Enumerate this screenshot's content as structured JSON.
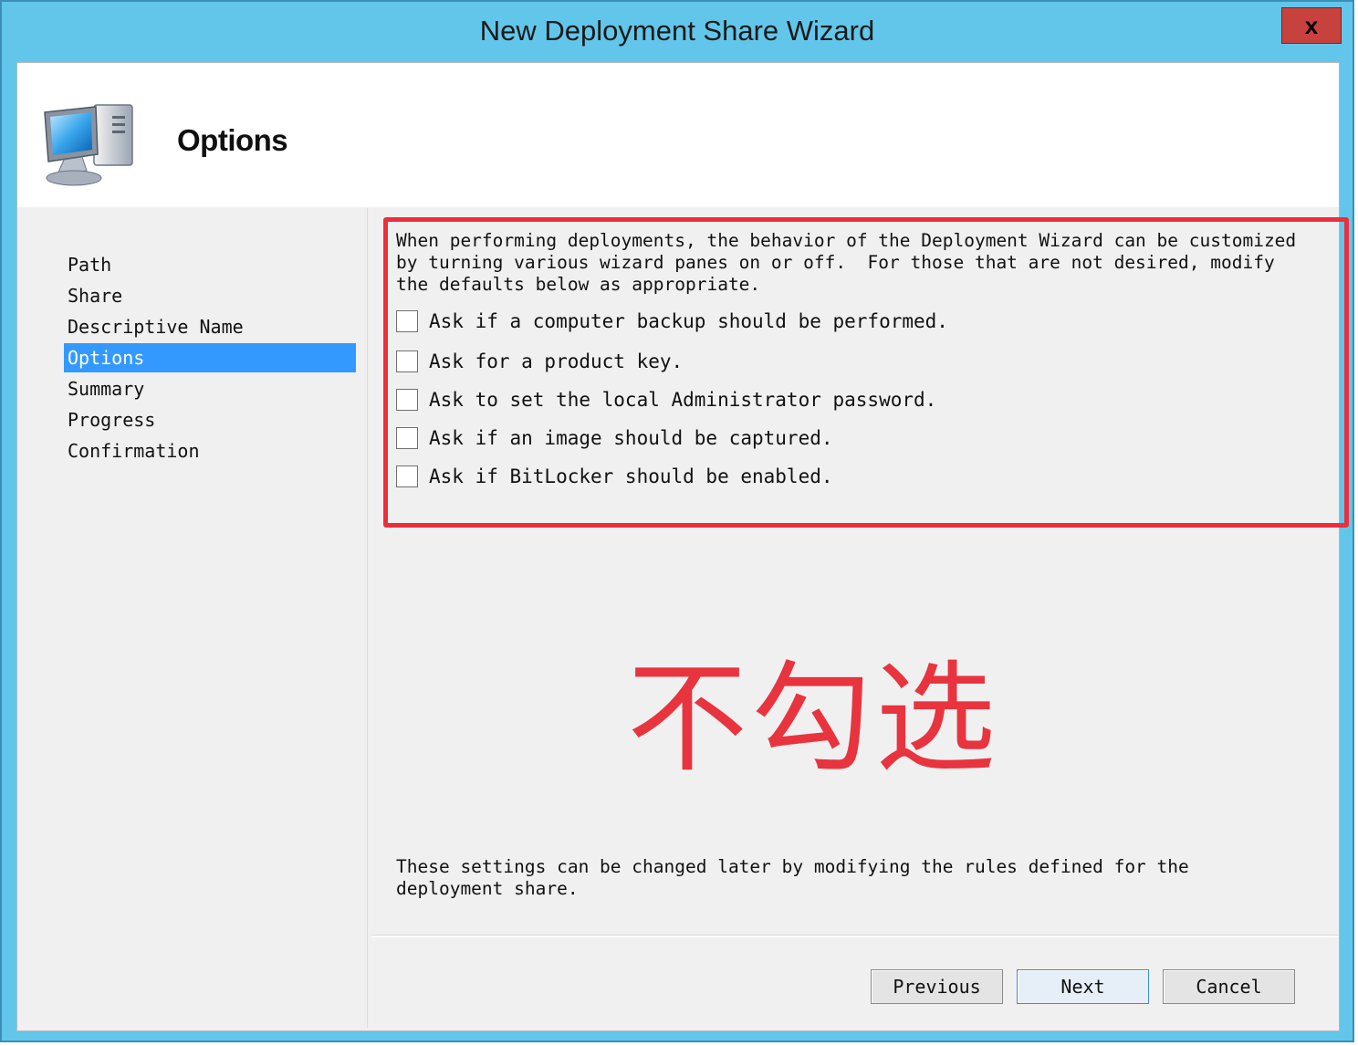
{
  "window": {
    "title": "New Deployment Share Wizard",
    "close_label": "x"
  },
  "header": {
    "title": "Options",
    "icon": "computer-icon"
  },
  "sidebar": {
    "items": [
      {
        "label": "Path",
        "active": false
      },
      {
        "label": "Share",
        "active": false
      },
      {
        "label": "Descriptive Name",
        "active": false
      },
      {
        "label": "Options",
        "active": true
      },
      {
        "label": "Summary",
        "active": false
      },
      {
        "label": "Progress",
        "active": false
      },
      {
        "label": "Confirmation",
        "active": false
      }
    ]
  },
  "content": {
    "intro": "When performing deployments, the behavior of the Deployment Wizard can be customized\nby turning various wizard panes on or off.  For those that are not desired, modify\nthe defaults below as appropriate.",
    "options": [
      {
        "label": "Ask if a computer backup should be performed.",
        "checked": false
      },
      {
        "label": "Ask for a product key.",
        "checked": false
      },
      {
        "label": "Ask to set the local Administrator password.",
        "checked": false
      },
      {
        "label": "Ask if an image should be captured.",
        "checked": false
      },
      {
        "label": "Ask if BitLocker should be enabled.",
        "checked": false
      }
    ],
    "annotation": "不勾选",
    "annotation_color": "#e8343e",
    "footer_note": "These settings can be changed later by modifying the rules defined for the\ndeployment share."
  },
  "buttons": {
    "previous": "Previous",
    "next": "Next",
    "cancel": "Cancel"
  },
  "colors": {
    "titlebar": "#62c6ea",
    "selection": "#3399ff",
    "highlight_border": "#ee2d3a",
    "close_button": "#c7413d"
  }
}
